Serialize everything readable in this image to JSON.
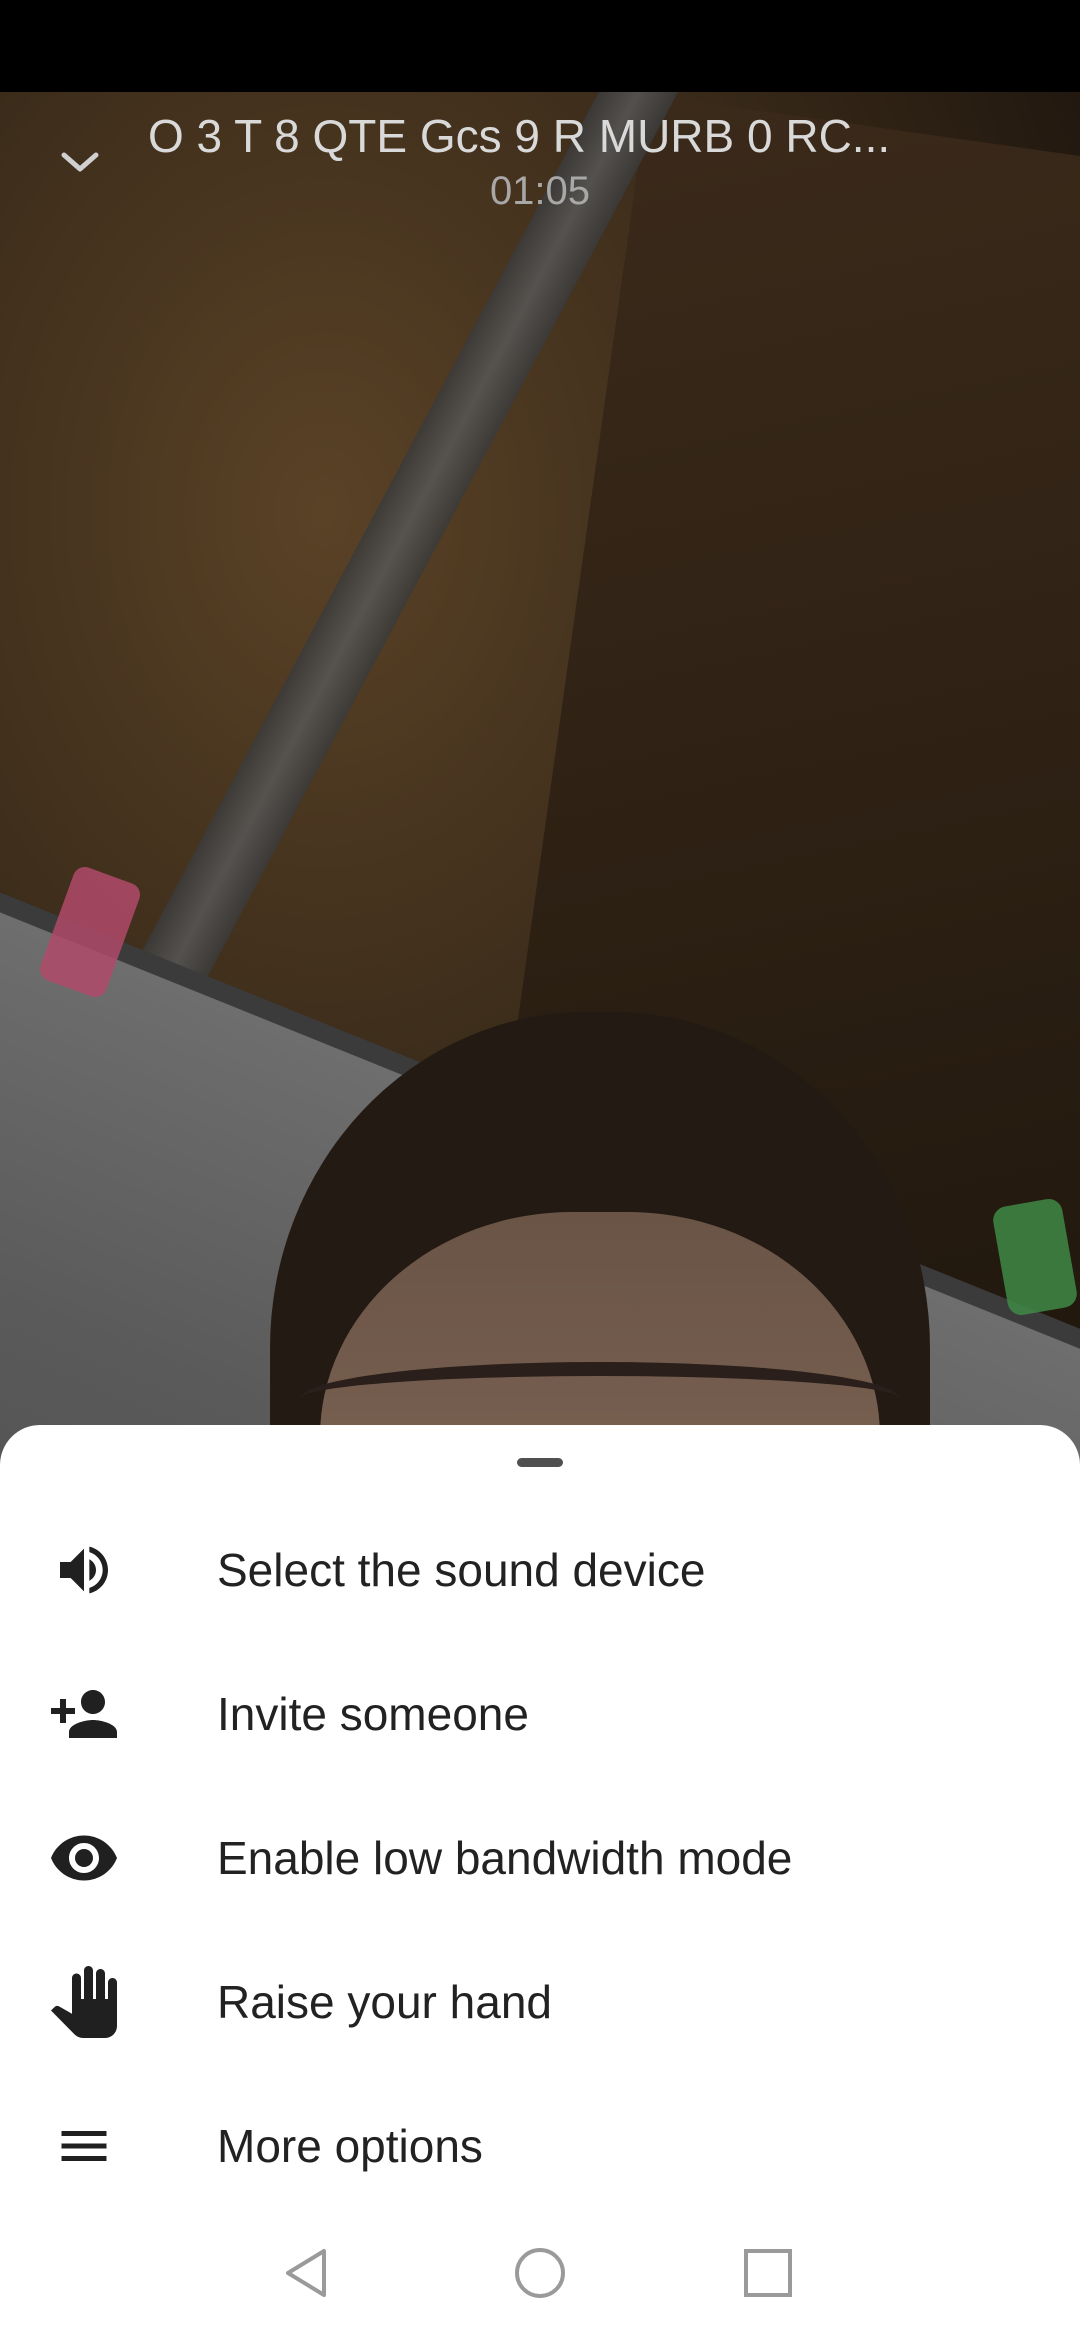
{
  "call": {
    "title": "O 3 T 8 QTE Gcs 9 R MURB 0 RC...",
    "timer": "01:05"
  },
  "icons": {
    "collapse": "chevron-down-icon",
    "sound": "volume-icon",
    "invite": "person-add-icon",
    "bandwidth": "eye-icon",
    "hand": "hand-icon",
    "more": "menu-icon"
  },
  "menu": {
    "items": [
      {
        "label": "Select the sound device",
        "icon": "volume-icon"
      },
      {
        "label": "Invite someone",
        "icon": "person-add-icon"
      },
      {
        "label": "Enable low bandwidth mode",
        "icon": "eye-icon"
      },
      {
        "label": "Raise your hand",
        "icon": "hand-icon"
      },
      {
        "label": "More options",
        "icon": "menu-icon"
      }
    ]
  },
  "nav": {
    "back": "back-icon",
    "home": "home-icon",
    "recents": "recents-icon"
  },
  "colors": {
    "sheet_bg": "#ffffff",
    "text": "#222222",
    "icon": "#202020",
    "header_text": "#d9d9d9",
    "nav_icon": "#9a9a9a"
  }
}
